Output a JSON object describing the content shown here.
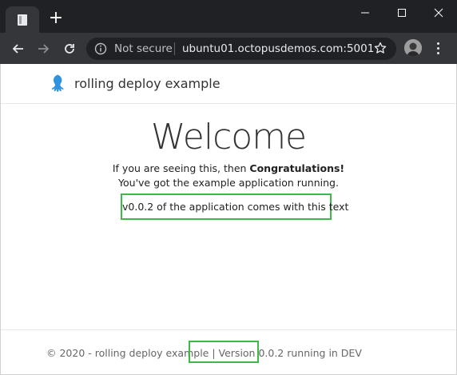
{
  "browser": {
    "new_tab_symbol": "+",
    "security_label": "Not secure",
    "url": "ubuntu01.octopusdemos.com:5001",
    "icons": [
      "back-icon",
      "forward-icon",
      "reload-icon",
      "info-icon",
      "star-icon",
      "menu-icon",
      "minimize-icon",
      "maximize-icon",
      "close-icon"
    ]
  },
  "site": {
    "brand": "rolling deploy example",
    "brand_color": "#2f93e0"
  },
  "main": {
    "heading": "Welcome",
    "intro_prefix": "If you are seeing this, then ",
    "intro_bold": "Congratulations!",
    "intro_line2": "You've got the example application running.",
    "version_note": "v0.0.2 of the application comes with this text",
    "highlight_color": "#3fb84a"
  },
  "footer": {
    "text": "© 2020 - rolling deploy example | Version 0.0.2 running in DEV"
  }
}
